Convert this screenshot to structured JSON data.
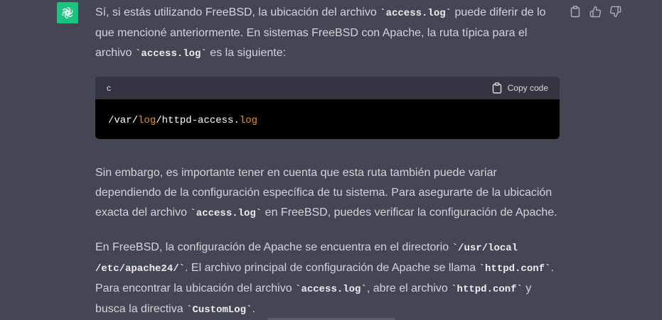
{
  "colors": {
    "background": "#444654",
    "text": "#d1d5db",
    "avatar": "#19c37d",
    "code_header": "#343541",
    "code_body": "#000000",
    "highlight": "#e9950c"
  },
  "icons": {
    "avatar": "openai-logo-icon",
    "copy": "clipboard-icon",
    "like": "thumbs-up-icon",
    "dislike": "thumbs-down-icon"
  },
  "message": {
    "p1": {
      "t1": "Sí, si estás utilizando FreeBSD, la ubicación del archivo ",
      "c1": "`access.log`",
      "t2": " puede diferir de lo que mencioné anteriormente. En sistemas FreeBSD con Apache, la ruta típica para el archivo ",
      "c2": "`access.log`",
      "t3": " es la siguiente:"
    },
    "code": {
      "language": "c",
      "copy_label": "Copy code",
      "parts": [
        "/var/",
        "log",
        "/httpd-access.",
        "log"
      ]
    },
    "p2": {
      "t1": "Sin embargo, es importante tener en cuenta que esta ruta también puede variar dependiendo de la configuración específica de tu sistema. Para asegurarte de la ubicación exacta del archivo ",
      "c1": "`access.log`",
      "t2": " en FreeBSD, puedes verificar la configuración de Apache."
    },
    "p3": {
      "t1": "En FreeBSD, la configuración de Apache se encuentra en el directorio ",
      "c1": "`/usr/local /etc/apache24/`",
      "t2": ". El archivo principal de configuración de Apache se llama ",
      "c2": "`httpd.conf`",
      "t3": ". Para encontrar la ubicación del archivo ",
      "c3": "`access.log`",
      "t4": ", abre el archivo ",
      "c4": "`httpd.conf`",
      "t5": " y busca la directiva ",
      "c5": "`CustomLog`",
      "t6": "."
    }
  }
}
